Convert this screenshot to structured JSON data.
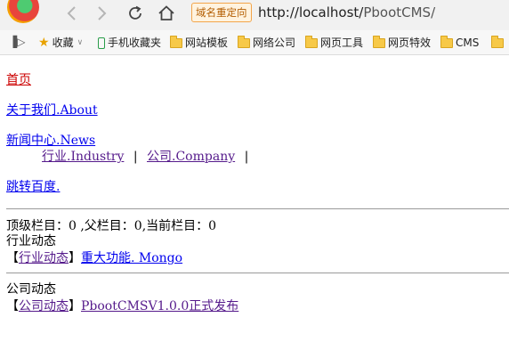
{
  "browser": {
    "redirect_badge": "域名重定向",
    "url_host": "http://localhost/",
    "url_path": "PbootCMS/",
    "bookmarks": [
      "收藏",
      "手机收藏夹",
      "网站模板",
      "网络公司",
      "网页工具",
      "网页特效",
      "CMS"
    ],
    "icons": [
      "back-icon",
      "forward-icon",
      "reload-icon",
      "home-icon",
      "star-icon",
      "folder-icon"
    ],
    "accent_color": "#f2a54a"
  },
  "nav": {
    "home": "首页",
    "about": "关于我们.About",
    "news": "新闻中心.News",
    "industry": "行业.Industry",
    "company": "公司.Company",
    "sep": "|",
    "baidu": "跳转百度."
  },
  "status": {
    "text": "顶级栏目：0 ,父栏目：0,当前栏目：0"
  },
  "sections": [
    {
      "title": "行业动态",
      "bracket_open": "【",
      "category": "行业动态",
      "bracket_close": "】",
      "article": "重大功能. Mongo"
    },
    {
      "title": "公司动态",
      "bracket_open": "【",
      "category": "公司动态",
      "bracket_close": "】",
      "article": "PbootCMSV1.0.0正式发布"
    }
  ]
}
